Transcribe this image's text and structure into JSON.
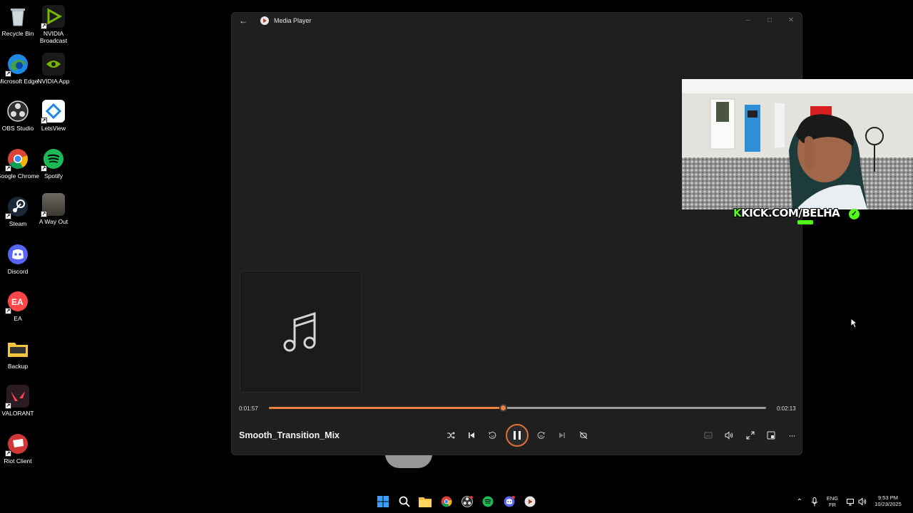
{
  "desktop": {
    "icons": [
      {
        "label": "Recycle Bin",
        "icon": "recycle-bin-icon"
      },
      {
        "label": "NVIDIA Broadcast",
        "icon": "nvidia-broadcast-icon"
      },
      {
        "label": "Microsoft Edge",
        "icon": "edge-icon"
      },
      {
        "label": "NVIDIA App",
        "icon": "nvidia-app-icon"
      },
      {
        "label": "OBS Studio",
        "icon": "obs-icon"
      },
      {
        "label": "LetsView",
        "icon": "letsview-icon"
      },
      {
        "label": "Google Chrome",
        "icon": "chrome-icon"
      },
      {
        "label": "Spotify",
        "icon": "spotify-icon"
      },
      {
        "label": "Steam",
        "icon": "steam-icon"
      },
      {
        "label": "A Way Out",
        "icon": "a-way-out-icon"
      },
      {
        "label": "Discord",
        "icon": "discord-icon"
      },
      {
        "label": "EA",
        "icon": "ea-icon"
      },
      {
        "label": "Backup",
        "icon": "folder-icon"
      },
      {
        "label": "VALORANT",
        "icon": "valorant-icon"
      },
      {
        "label": "Riot Client",
        "icon": "riot-client-icon"
      }
    ]
  },
  "media_player": {
    "title": "Media Player",
    "elapsed": "0:01:57",
    "duration": "0:02:13",
    "progress_fraction": 0.47,
    "song_title": "Smooth_Transition_Mix",
    "accent": "#f08040"
  },
  "webcam": {
    "label_k": "K",
    "label_text": "KICK.COM/BELHA"
  },
  "tray": {
    "lang_top": "ENG",
    "lang_bottom": "FR",
    "time": "9:53 PM",
    "date": "10/23/2025"
  }
}
